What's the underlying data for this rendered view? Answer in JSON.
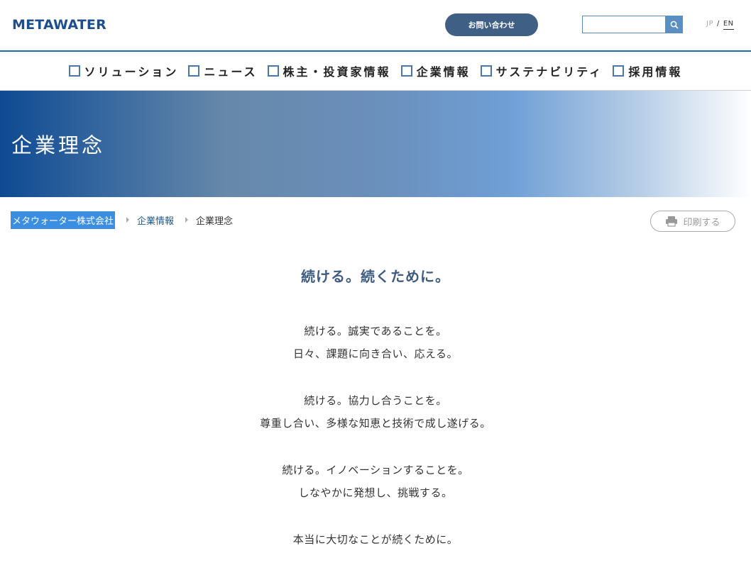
{
  "header": {
    "logo": "METAWATER",
    "contact_label": "お問い合わせ",
    "search_placeholder": "",
    "lang_jp": "JP",
    "lang_sep": "/",
    "lang_en": "EN"
  },
  "nav": {
    "items": [
      {
        "label": "ソリューション"
      },
      {
        "label": "ニュース"
      },
      {
        "label": "株主・投資家情報"
      },
      {
        "label": "企業情報"
      },
      {
        "label": "サステナビリティ"
      },
      {
        "label": "採用情報"
      }
    ]
  },
  "hero": {
    "title": "企業理念"
  },
  "breadcrumb": {
    "home": "メタウォーター株式会社",
    "parent": "企業情報",
    "current": "企業理念"
  },
  "print_label": "印刷する",
  "content": {
    "lead": "続ける。続くために。",
    "paragraphs": [
      {
        "lines": [
          "続ける。誠実であることを。",
          "日々、課題に向き合い、応える。"
        ]
      },
      {
        "lines": [
          "続ける。協力し合うことを。",
          "尊重し合い、多様な知恵と技術で成し遂げる。"
        ]
      },
      {
        "lines": [
          "続ける。イノベーションすることを。",
          "しなやかに発想し、挑戦する。"
        ]
      },
      {
        "lines": [
          "本当に大切なことが続くために。"
        ]
      }
    ]
  },
  "colors": {
    "brand": "#1d4f8f",
    "nav_box": "#4a79a8",
    "contact_button": "#3f5f84",
    "lead_text": "#3e5c80",
    "breadcrumb_highlight": "#3c8fe0"
  }
}
